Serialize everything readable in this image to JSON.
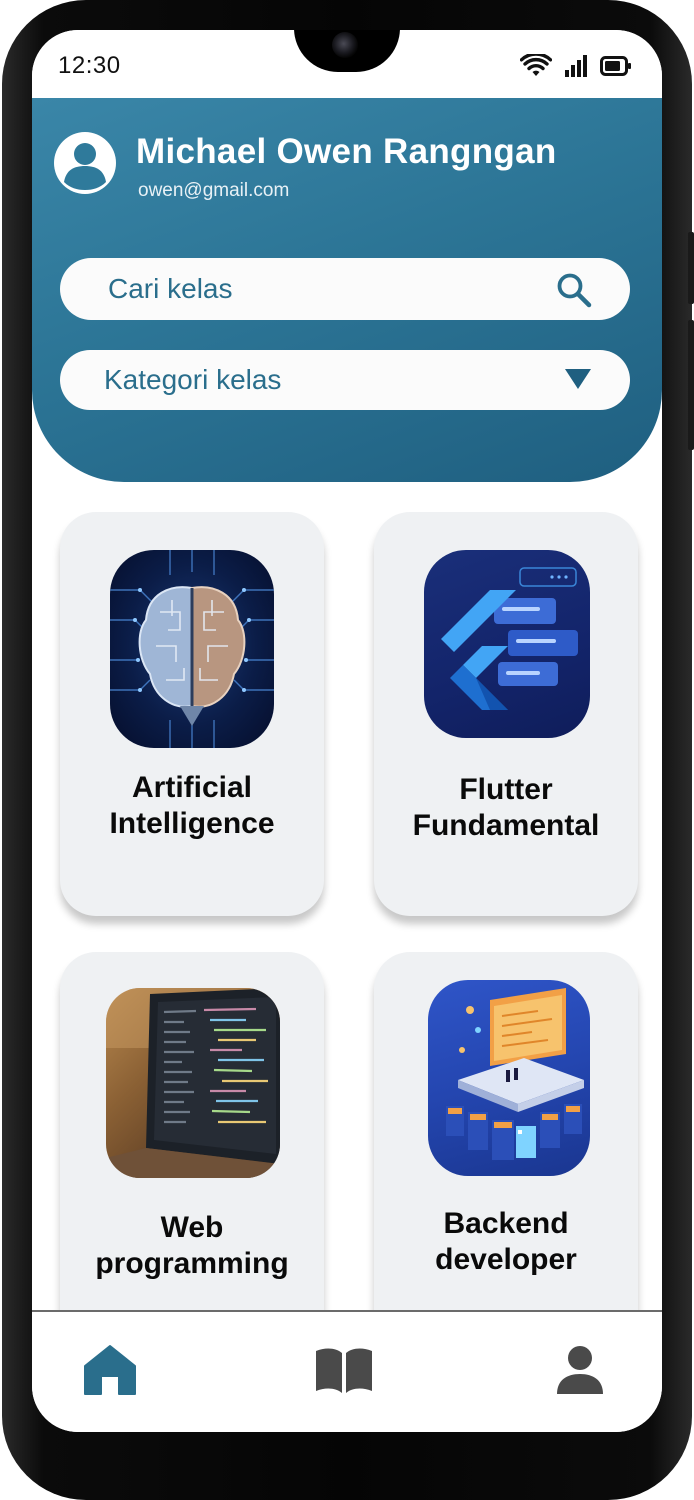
{
  "status_bar": {
    "time": "12:30",
    "icons": [
      "wifi-icon",
      "signal-icon",
      "battery-icon"
    ]
  },
  "profile": {
    "name": "Michael Owen Rangngan",
    "email": "owen@gmail.com",
    "avatar_icon": "user-avatar-icon"
  },
  "search": {
    "placeholder": "Cari kelas",
    "icon": "search-icon"
  },
  "category": {
    "label": "Kategori kelas",
    "icon": "triangle-down-icon"
  },
  "courses": [
    {
      "title_line1": "Artificial",
      "title_line2": "Intelligence",
      "image": "ai-brain-circuit-image"
    },
    {
      "title_line1": "Flutter",
      "title_line2": "Fundamental",
      "image": "flutter-logo-image"
    },
    {
      "title_line1": "Web",
      "title_line2": "programming",
      "image": "laptop-code-image"
    },
    {
      "title_line1": "Backend",
      "title_line2": "developer",
      "image": "isometric-server-image"
    }
  ],
  "bottom_nav": [
    {
      "name": "home",
      "icon": "home-icon",
      "active": true
    },
    {
      "name": "courses",
      "icon": "book-icon",
      "active": false
    },
    {
      "name": "profile",
      "icon": "person-icon",
      "active": false
    }
  ],
  "colors": {
    "header_start": "#3a86a8",
    "header_end": "#1f5f80",
    "accent_text": "#2a6e8c",
    "nav_active": "#2a6e8c",
    "nav_inactive": "#4a4a4a",
    "card_bg": "#eff1f3"
  }
}
